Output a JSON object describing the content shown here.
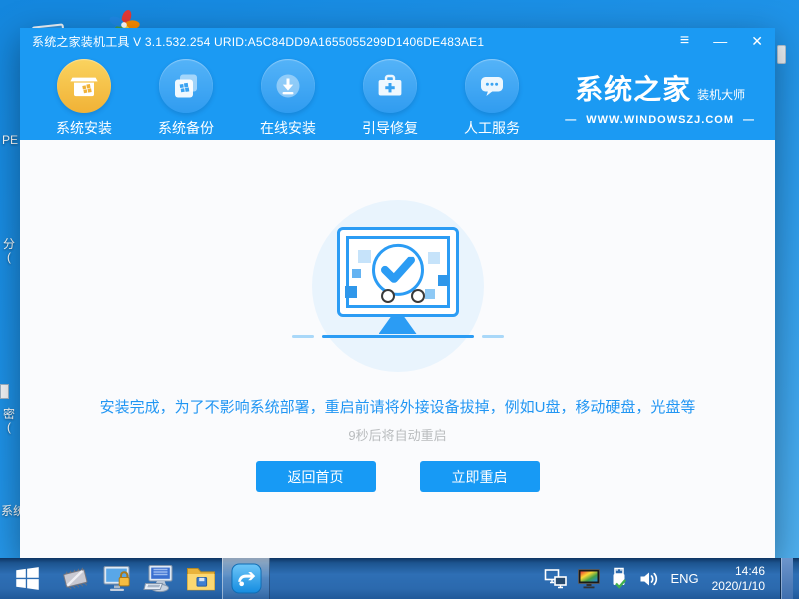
{
  "desktop": {
    "fragments": {
      "label_pe": "PE",
      "label_fen": "分\n(",
      "label_mi": "密\n(",
      "label_xitong": "系统"
    }
  },
  "window": {
    "title": "系统之家装机工具 V 3.1.532.254 URID:A5C84DD9A1655055299D1406DE483AE1",
    "controls": {
      "menu": "≡",
      "minimize": "—",
      "close": "✕"
    },
    "nav": {
      "items": [
        {
          "label": "系统安装",
          "icon": "install-box-icon",
          "active": true
        },
        {
          "label": "系统备份",
          "icon": "backup-copies-icon",
          "active": false
        },
        {
          "label": "在线安装",
          "icon": "download-circle-icon",
          "active": false
        },
        {
          "label": "引导修复",
          "icon": "repair-toolbox-icon",
          "active": false
        },
        {
          "label": "人工服务",
          "icon": "chat-bubble-icon",
          "active": false
        }
      ]
    },
    "brand": {
      "name": "系统之家",
      "suffix": "装机大师",
      "site": "WWW.WINDOWSZJ.COM",
      "dash": "—"
    },
    "main": {
      "message": "安装完成，为了不影响系统部署，重启前请将外接设备拔掉，例如U盘，移动硬盘，光盘等",
      "countdown": "9秒后将自动重启",
      "buttons": {
        "home": "返回首页",
        "restart": "立即重启"
      }
    }
  },
  "taskbar": {
    "language": "ENG",
    "time": "14:46",
    "date": "2020/1/10"
  },
  "colors": {
    "titlebar_blue": "#1b9af3",
    "nav_circle_blue": "#41a8f3",
    "active_gold": "#f5bd3d",
    "button_blue": "#179af5",
    "message_blue": "#2196f3",
    "countdown_gray": "#b9bcbe",
    "illustration_bg": "#e9f4fd",
    "monitor_stroke": "#2b9cf4",
    "taskbar_blue": "#2e6fb5",
    "desktop_blue": "#1f93e8"
  }
}
